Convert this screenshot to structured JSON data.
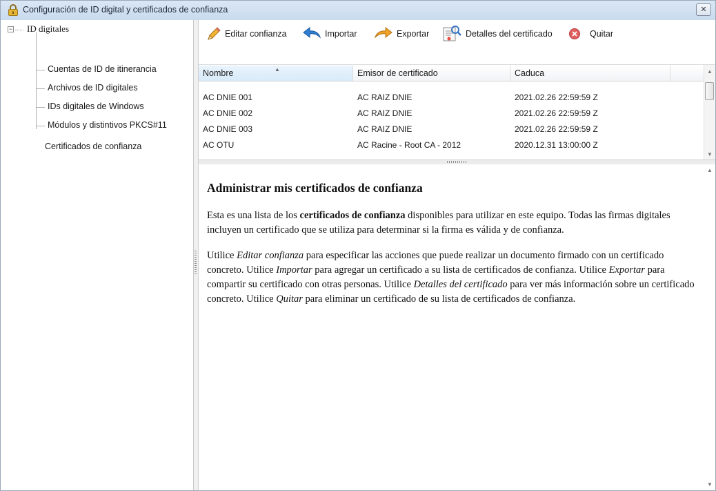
{
  "window": {
    "title": "Configuración de ID digital y certificados de confianza"
  },
  "tree": {
    "root": "ID digitales",
    "children": [
      "Cuentas de ID de itinerancia",
      "Archivos de ID digitales",
      "IDs digitales de Windows",
      "Módulos y distintivos PKCS#11"
    ],
    "selected": "Certificados de confianza"
  },
  "toolbar": {
    "edit": "Editar confianza",
    "import": "Importar",
    "export": "Exportar",
    "details": "Detalles del certificado",
    "remove": "Quitar"
  },
  "grid": {
    "columns": [
      "Nombre",
      "Emisor de certificado",
      "Caduca"
    ],
    "rows": [
      [
        "AC DNIE 001",
        "AC RAIZ DNIE",
        "2021.02.26 22:59:59 Z"
      ],
      [
        "AC DNIE 002",
        "AC RAIZ DNIE",
        "2021.02.26 22:59:59 Z"
      ],
      [
        "AC DNIE 003",
        "AC RAIZ DNIE",
        "2021.02.26 22:59:59 Z"
      ],
      [
        "AC OTU",
        "AC Racine - Root CA - 2012",
        "2020.12.31 13:00:00 Z"
      ]
    ]
  },
  "details": {
    "heading": "Administrar mis certificados de confianza",
    "p1": {
      "a": "Esta es una lista de los ",
      "b": "certificados de confianza",
      "c": " disponibles para utilizar en este equipo. Todas las firmas digitales incluyen un certificado que se utiliza para determinar si la firma es válida y de confianza."
    },
    "p2": {
      "s1": "Utilice ",
      "e1": "Editar confianza",
      "s2": " para especificar las acciones que puede realizar un documento firmado con un certificado concreto. Utilice ",
      "e2": "Importar",
      "s3": " para agregar un certificado a su lista de certificados de confianza. Utilice ",
      "e3": "Exportar",
      "s4": " para compartir su certificado con otras personas. Utilice ",
      "e4": "Detalles del certificado",
      "s5": " para ver más información sobre un certificado concreto. Utilice ",
      "e5": "Quitar",
      "s6": " para eliminar un certificado de su lista de certificados de confianza."
    }
  }
}
